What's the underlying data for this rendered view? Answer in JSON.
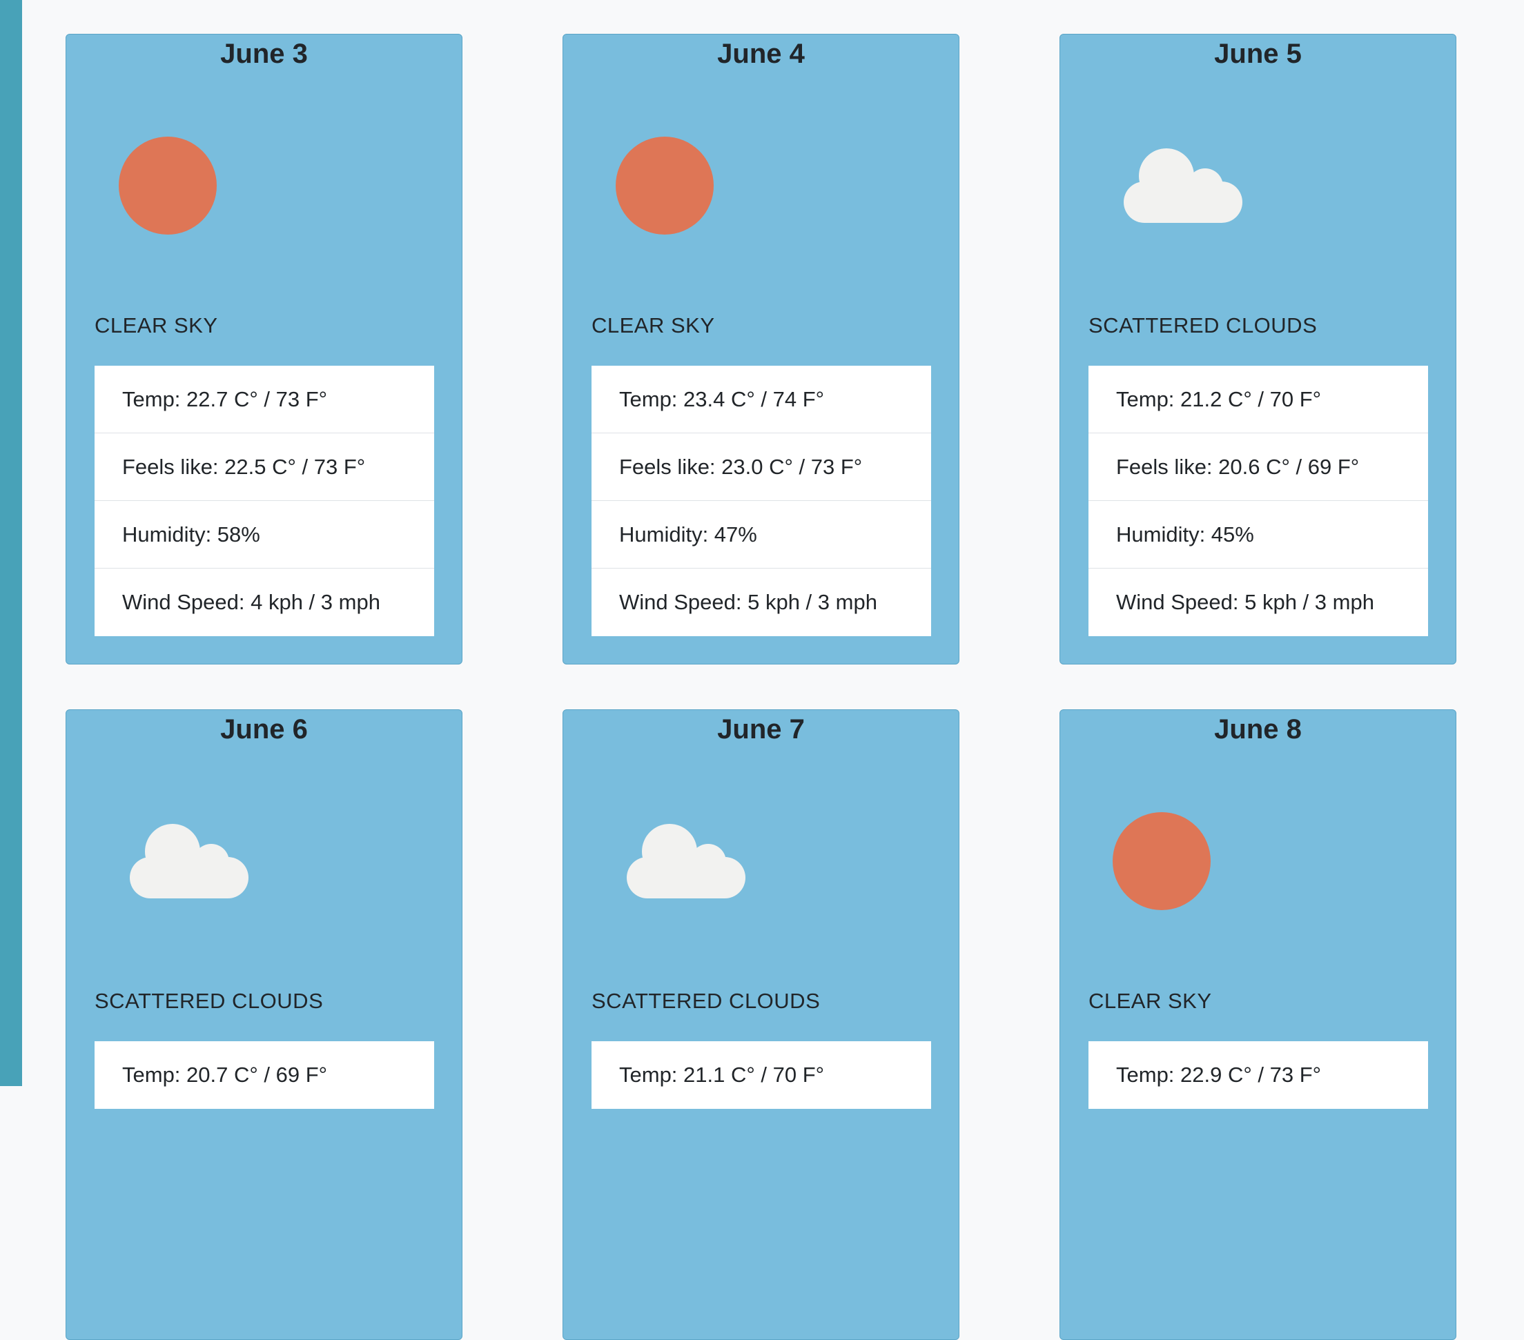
{
  "forecast": [
    {
      "date": "June 3",
      "icon": "sun-icon",
      "condition": "CLEAR SKY",
      "temp": "Temp: 22.7 C° / 73 F°",
      "feels_like": "Feels like: 22.5 C° / 73 F°",
      "humidity": "Humidity: 58%",
      "wind": "Wind Speed: 4 kph / 3 mph"
    },
    {
      "date": "June 4",
      "icon": "sun-icon",
      "condition": "CLEAR SKY",
      "temp": "Temp: 23.4 C° / 74 F°",
      "feels_like": "Feels like: 23.0 C° / 73 F°",
      "humidity": "Humidity: 47%",
      "wind": "Wind Speed: 5 kph / 3 mph"
    },
    {
      "date": "June 5",
      "icon": "cloud-icon",
      "condition": "SCATTERED CLOUDS",
      "temp": "Temp: 21.2 C° / 70 F°",
      "feels_like": "Feels like: 20.6 C° / 69 F°",
      "humidity": "Humidity: 45%",
      "wind": "Wind Speed: 5 kph / 3 mph"
    },
    {
      "date": "June 6",
      "icon": "cloud-icon",
      "condition": "SCATTERED CLOUDS",
      "temp": "Temp: 20.7 C° / 69 F°"
    },
    {
      "date": "June 7",
      "icon": "cloud-icon",
      "condition": "SCATTERED CLOUDS",
      "temp": "Temp: 21.1 C° / 70 F°"
    },
    {
      "date": "June 8",
      "icon": "sun-icon",
      "condition": "CLEAR SKY",
      "temp": "Temp: 22.9 C° / 73 F°"
    }
  ],
  "colors": {
    "card_background": "#79bddd",
    "sun": "#de7656",
    "cloud": "#f2f2f0",
    "accent_bar": "#48a2b8",
    "page_background": "#f8f9fa"
  }
}
